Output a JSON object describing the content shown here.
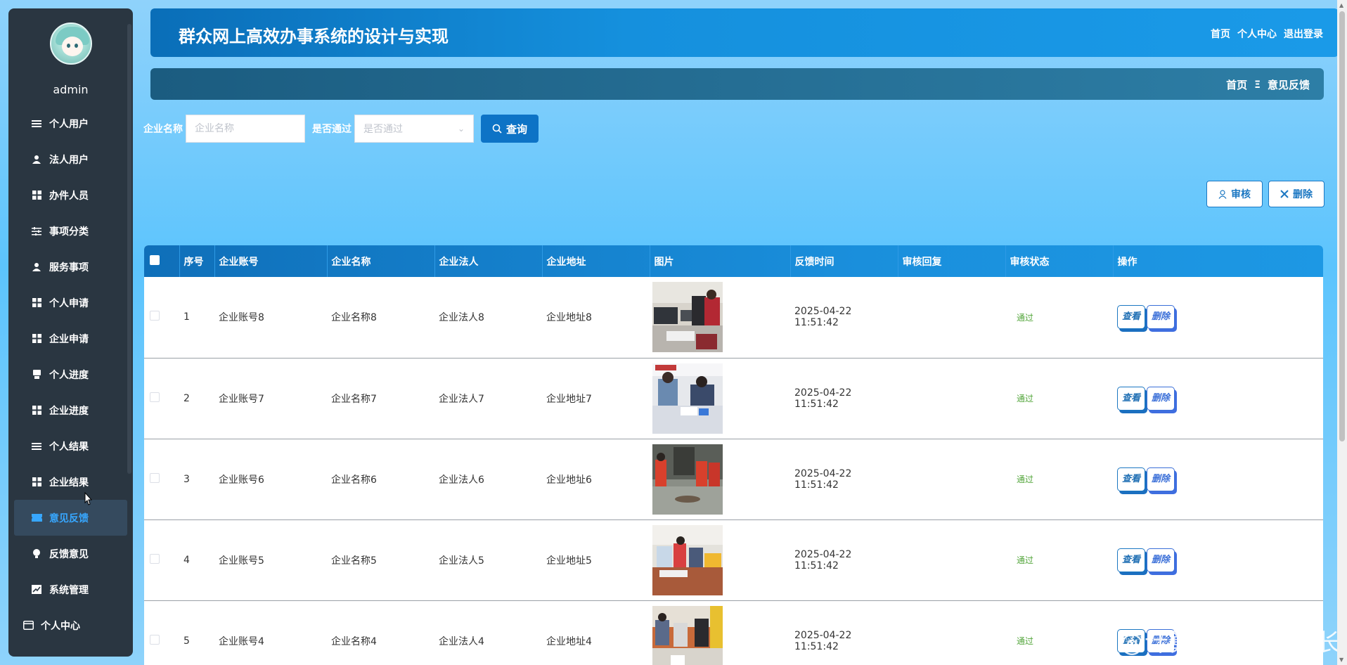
{
  "sidebar": {
    "username": "admin",
    "items": [
      {
        "label": "个人用户",
        "icon": "list-icon"
      },
      {
        "label": "法人用户",
        "icon": "user-icon"
      },
      {
        "label": "办件人员",
        "icon": "grid-icon"
      },
      {
        "label": "事项分类",
        "icon": "sliders-icon"
      },
      {
        "label": "服务事项",
        "icon": "user-icon"
      },
      {
        "label": "个人申请",
        "icon": "grid-icon"
      },
      {
        "label": "企业申请",
        "icon": "grid-icon"
      },
      {
        "label": "个人进度",
        "icon": "printer-icon"
      },
      {
        "label": "企业进度",
        "icon": "grid-icon"
      },
      {
        "label": "个人结果",
        "icon": "list-icon"
      },
      {
        "label": "企业结果",
        "icon": "grid-icon"
      },
      {
        "label": "意见反馈",
        "icon": "ticket-icon"
      },
      {
        "label": "反馈意见",
        "icon": "bulb-icon"
      },
      {
        "label": "系统管理",
        "icon": "chart-icon"
      }
    ],
    "user_center": "个人中心",
    "active_index": 11
  },
  "header": {
    "title": "群众网上高效办事系统的设计与实现",
    "links": [
      "首页",
      "个人中心",
      "退出登录"
    ]
  },
  "breadcrumb": {
    "home": "首页",
    "separator": "Ξ",
    "current": "意见反馈"
  },
  "search": {
    "company_label": "企业名称",
    "company_placeholder": "企业名称",
    "passed_label": "是否通过",
    "passed_placeholder": "是否通过",
    "query_button": "查询"
  },
  "actions": {
    "review": "审核",
    "delete": "删除"
  },
  "table": {
    "headers": [
      "序号",
      "企业账号",
      "企业名称",
      "企业法人",
      "企业地址",
      "图片",
      "反馈时间",
      "审核回复",
      "审核状态",
      "操作"
    ],
    "rows": [
      {
        "index": "1",
        "account": "企业账号8",
        "name": "企业名称8",
        "legal": "企业法人8",
        "address": "企业地址8",
        "time": "2025-04-22 11:51:42",
        "reply": "",
        "status": "通过"
      },
      {
        "index": "2",
        "account": "企业账号7",
        "name": "企业名称7",
        "legal": "企业法人7",
        "address": "企业地址7",
        "time": "2025-04-22 11:51:42",
        "reply": "",
        "status": "通过"
      },
      {
        "index": "3",
        "account": "企业账号6",
        "name": "企业名称6",
        "legal": "企业法人6",
        "address": "企业地址6",
        "time": "2025-04-22 11:51:42",
        "reply": "",
        "status": "通过"
      },
      {
        "index": "4",
        "account": "企业账号5",
        "name": "企业名称5",
        "legal": "企业法人5",
        "address": "企业地址5",
        "time": "2025-04-22 11:51:42",
        "reply": "",
        "status": "通过"
      },
      {
        "index": "5",
        "account": "企业账号4",
        "name": "企业名称4",
        "legal": "企业法人4",
        "address": "企业地址4",
        "time": "2025-04-22 11:51:42",
        "reply": "",
        "status": "通过"
      }
    ],
    "row_view": "查看",
    "row_delete": "删除"
  },
  "watermark": "CSDN @计算机程序猿学长"
}
